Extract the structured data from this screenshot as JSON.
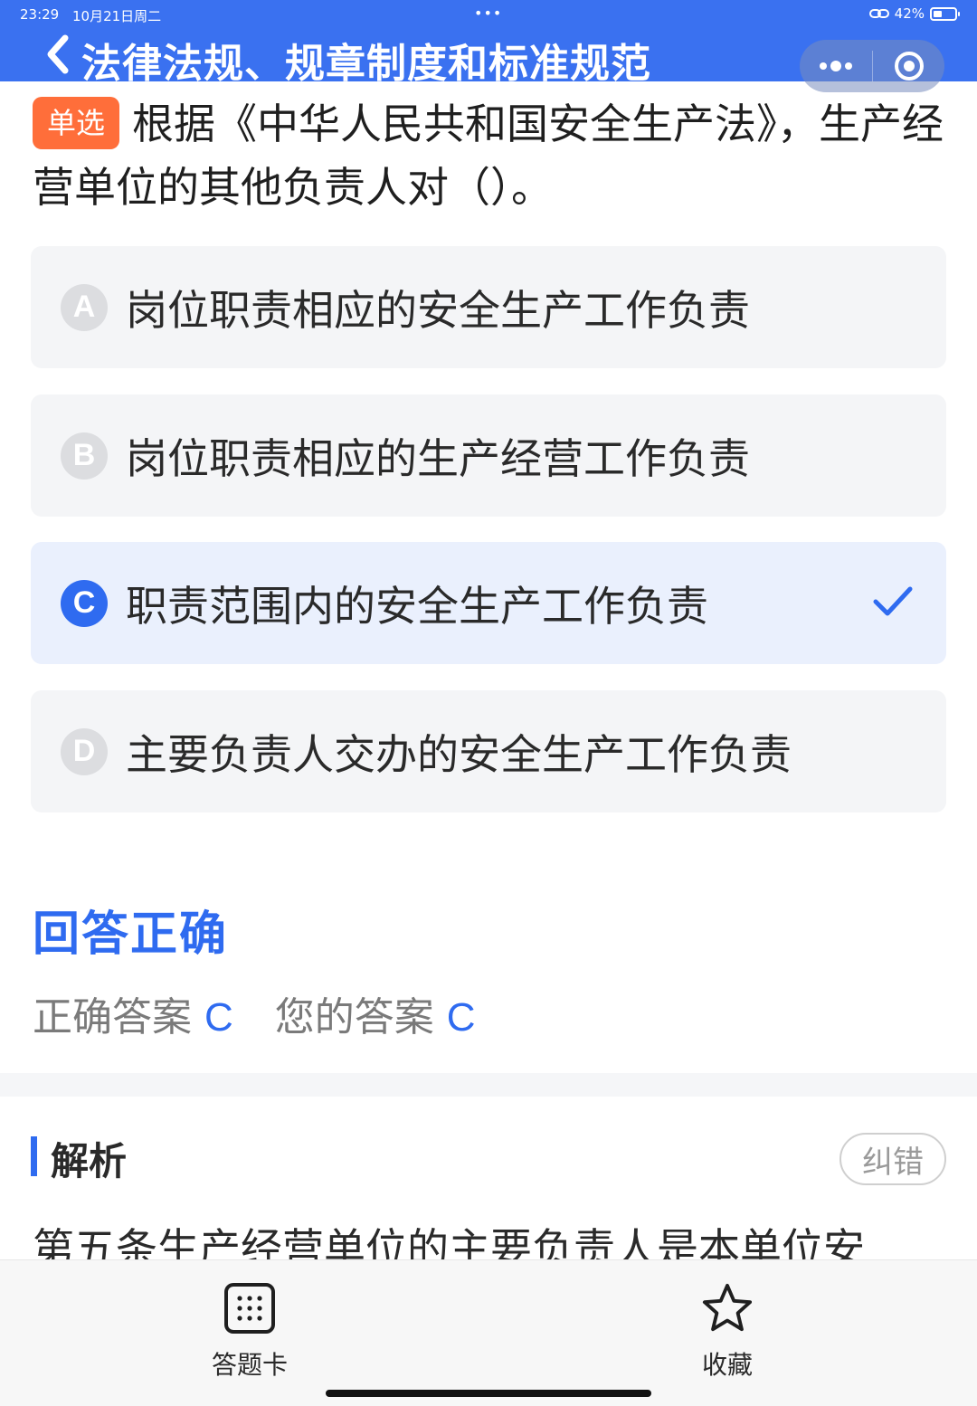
{
  "status_bar": {
    "time": "23:29",
    "date": "10月21日周二",
    "dots": "•••",
    "battery_percent": "42%"
  },
  "header": {
    "title": "法律法规、规章制度和标准规范"
  },
  "question": {
    "type_badge": "单选",
    "text": "根据《中华人民共和国安全生产法》，生产经营单位的其他负责人对（）。"
  },
  "options": [
    {
      "letter": "A",
      "text": "岗位职责相应的安全生产工作负责",
      "selected": false
    },
    {
      "letter": "B",
      "text": "岗位职责相应的生产经营工作负责",
      "selected": false
    },
    {
      "letter": "C",
      "text": "职责范围内的安全生产工作负责",
      "selected": true
    },
    {
      "letter": "D",
      "text": "主要负责人交办的安全生产工作负责",
      "selected": false
    }
  ],
  "result": {
    "title": "回答正确",
    "correct_label": "正确答案",
    "correct_value": "C",
    "your_label": "您的答案",
    "your_value": "C"
  },
  "analysis": {
    "title": "解析",
    "correction_button": "纠错",
    "text": "第五条生产经营单位的主要负责人是本单位安"
  },
  "bottom_bar": {
    "answer_card_label": "答题卡",
    "favorite_label": "收藏"
  },
  "colors": {
    "header_blue": "#3a71f0",
    "accent_blue": "#2f6bf0",
    "badge_orange": "#ff6e3a",
    "option_bg": "#f4f5f7",
    "selected_bg": "#eaf0fd"
  }
}
